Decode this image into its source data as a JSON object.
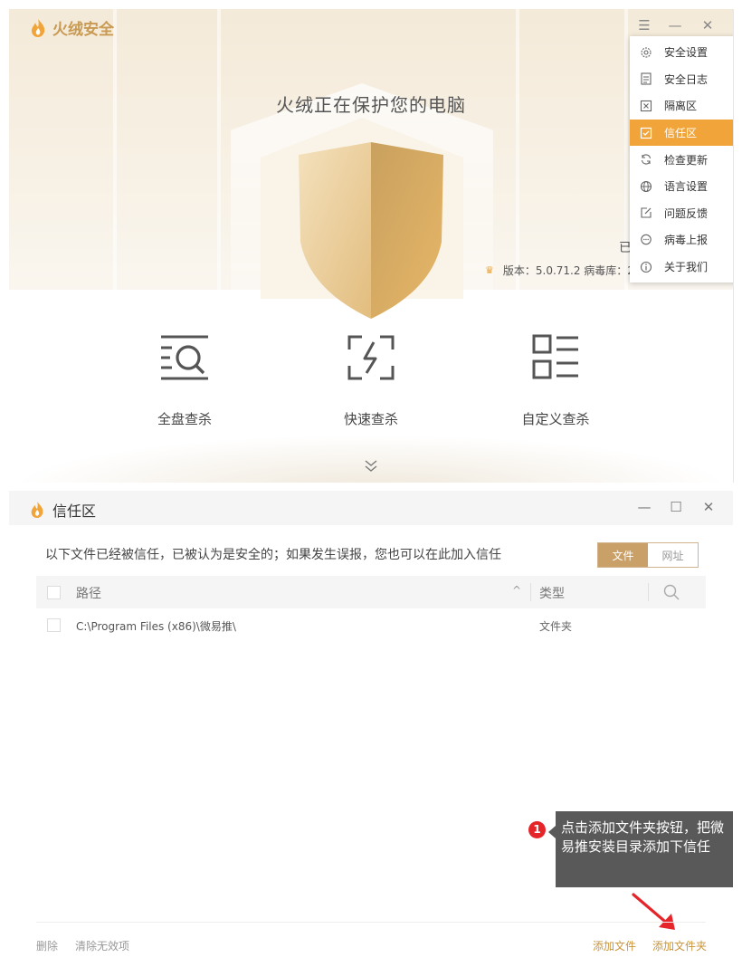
{
  "main_window": {
    "app_name": "火绒安全",
    "controls": {
      "menu_icon": "☰",
      "minimize": "—",
      "close": "✕"
    },
    "status": "火绒正在保护您的电脑",
    "side_partial": "已",
    "version_text": "版本：5.0.71.2  病毒库：2",
    "features": [
      {
        "label": "全盘查杀",
        "icon": "full-scan-icon"
      },
      {
        "label": "快速查杀",
        "icon": "quick-scan-icon"
      },
      {
        "label": "自定义查杀",
        "icon": "custom-scan-icon"
      }
    ],
    "menu": {
      "items": [
        {
          "label": "安全设置",
          "icon": "gear-icon"
        },
        {
          "label": "安全日志",
          "icon": "log-icon"
        },
        {
          "label": "隔离区",
          "icon": "quarantine-icon"
        },
        {
          "label": "信任区",
          "icon": "trust-check-icon",
          "active": true
        },
        {
          "label": "检查更新",
          "icon": "refresh-icon"
        },
        {
          "label": "语言设置",
          "icon": "globe-icon"
        },
        {
          "label": "问题反馈",
          "icon": "edit-icon"
        },
        {
          "label": "病毒上报",
          "icon": "chat-icon"
        },
        {
          "label": "关于我们",
          "icon": "info-icon"
        }
      ]
    }
  },
  "trust_window": {
    "title": "信任区",
    "controls": {
      "minimize": "—",
      "maximize": "☐",
      "close": "✕"
    },
    "description": "以下文件已经被信任，已被认为是安全的；如果发生误报，您也可以在此加入信任",
    "tabs": [
      {
        "label": "文件",
        "selected": true
      },
      {
        "label": "网址",
        "selected": false
      }
    ],
    "table": {
      "columns": {
        "path": "路径",
        "sort": "^",
        "type": "类型"
      },
      "rows": [
        {
          "path": "C:\\Program Files (x86)\\微易推\\",
          "type": "文件夹"
        }
      ]
    },
    "footer": {
      "delete": "删除",
      "clear_invalid": "清除无效项",
      "add_file": "添加文件",
      "add_folder": "添加文件夹"
    },
    "annotation": {
      "number": "1",
      "text": "点击添加文件夹按钮，把微易推安装目录添加下信任"
    }
  },
  "colors": {
    "brand_gold": "#c89a52",
    "menu_active": "#f0a43a",
    "tab_selected": "#c9a068",
    "footer_action": "#c9943a",
    "annotation_red": "#e5252a"
  }
}
